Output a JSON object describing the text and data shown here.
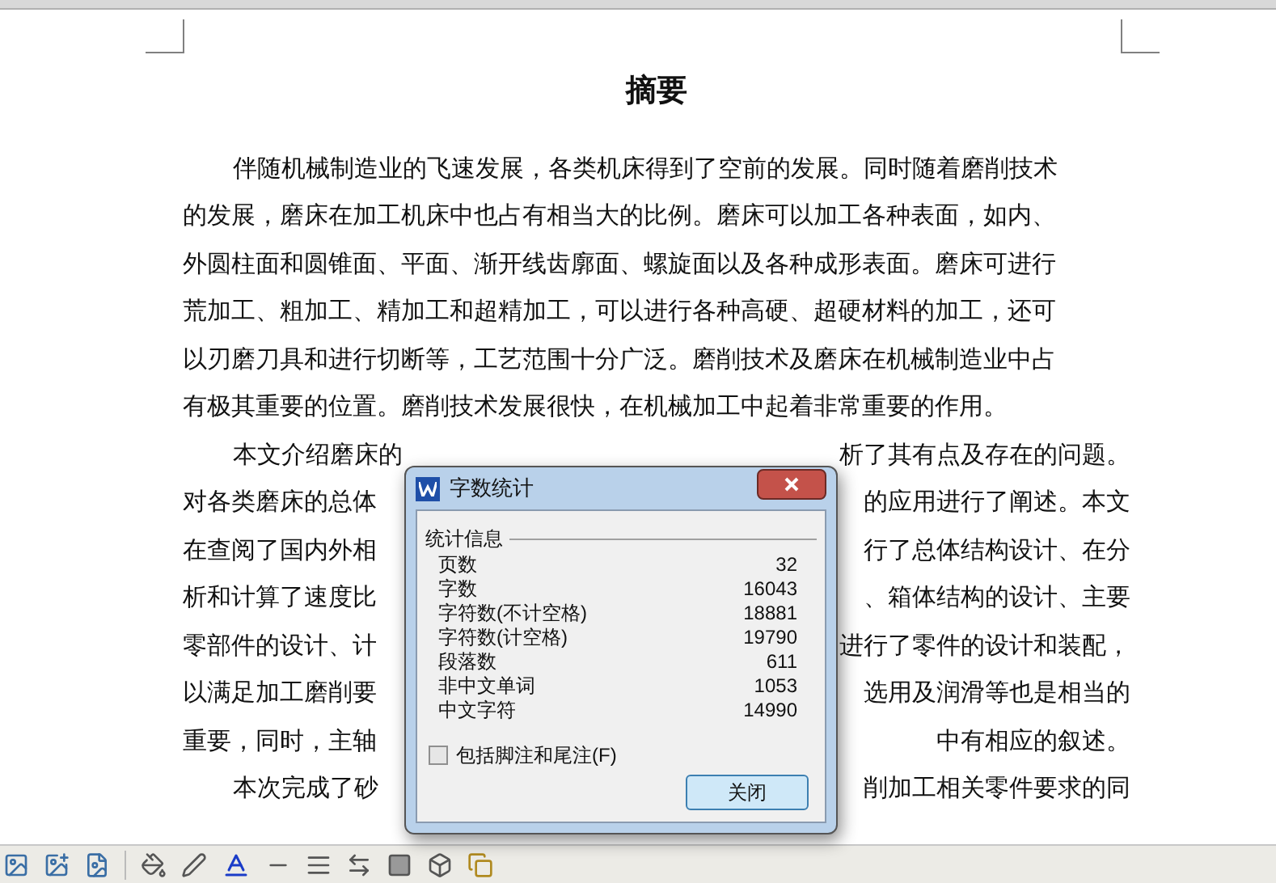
{
  "document": {
    "title": "摘要",
    "lines": [
      {
        "indent": true,
        "left": "伴随机械制造业的飞速发展，各类机床得到了空前的发展。同时随着磨削技术"
      },
      {
        "indent": false,
        "left": "的发展，磨床在加工机床中也占有相当大的比例。磨床可以加工各种表面，如内、"
      },
      {
        "indent": false,
        "left": "外圆柱面和圆锥面、平面、渐开线齿廓面、螺旋面以及各种成形表面。磨床可进行"
      },
      {
        "indent": false,
        "left": "荒加工、粗加工、精加工和超精加工，可以进行各种高硬、超硬材料的加工，还可"
      },
      {
        "indent": false,
        "left": "以刃磨刀具和进行切断等，工艺范围十分广泛。磨削技术及磨床在机械制造业中占"
      },
      {
        "indent": false,
        "left": "有极其重要的位置。磨削技术发展很快，在机械加工中起着非常重要的作用。"
      },
      {
        "indent": true,
        "left": "本文介绍磨床的",
        "right": "析了其有点及存在的问题。"
      },
      {
        "indent": false,
        "left": "对各类磨床的总体",
        "right": "的应用进行了阐述。本文"
      },
      {
        "indent": false,
        "left": "在查阅了国内外相",
        "right": "行了总体结构设计、在分"
      },
      {
        "indent": false,
        "left": "析和计算了速度比",
        "right": "、箱体结构的设计、主要"
      },
      {
        "indent": false,
        "left": "零部件的设计、计",
        "right": "进行了零件的设计和装配，"
      },
      {
        "indent": false,
        "left": "以满足加工磨削要",
        "right": "选用及润滑等也是相当的"
      },
      {
        "indent": false,
        "left": "重要，同时，主轴",
        "right": "中有相应的叙述。"
      },
      {
        "indent": true,
        "left": "本次完成了砂",
        "right": "削加工相关零件要求的同"
      }
    ]
  },
  "dialog": {
    "title": "字数统计",
    "group_label": "统计信息",
    "stats": [
      {
        "label": "页数",
        "value": "32"
      },
      {
        "label": "字数",
        "value": "16043"
      },
      {
        "label": "字符数(不计空格)",
        "value": "18881"
      },
      {
        "label": "字符数(计空格)",
        "value": "19790"
      },
      {
        "label": "段落数",
        "value": "611"
      },
      {
        "label": "非中文单词",
        "value": "1053"
      },
      {
        "label": "中文字符",
        "value": "14990"
      }
    ],
    "checkbox": {
      "label": "包括脚注和尾注(F)",
      "checked": false
    },
    "button": "关闭"
  }
}
